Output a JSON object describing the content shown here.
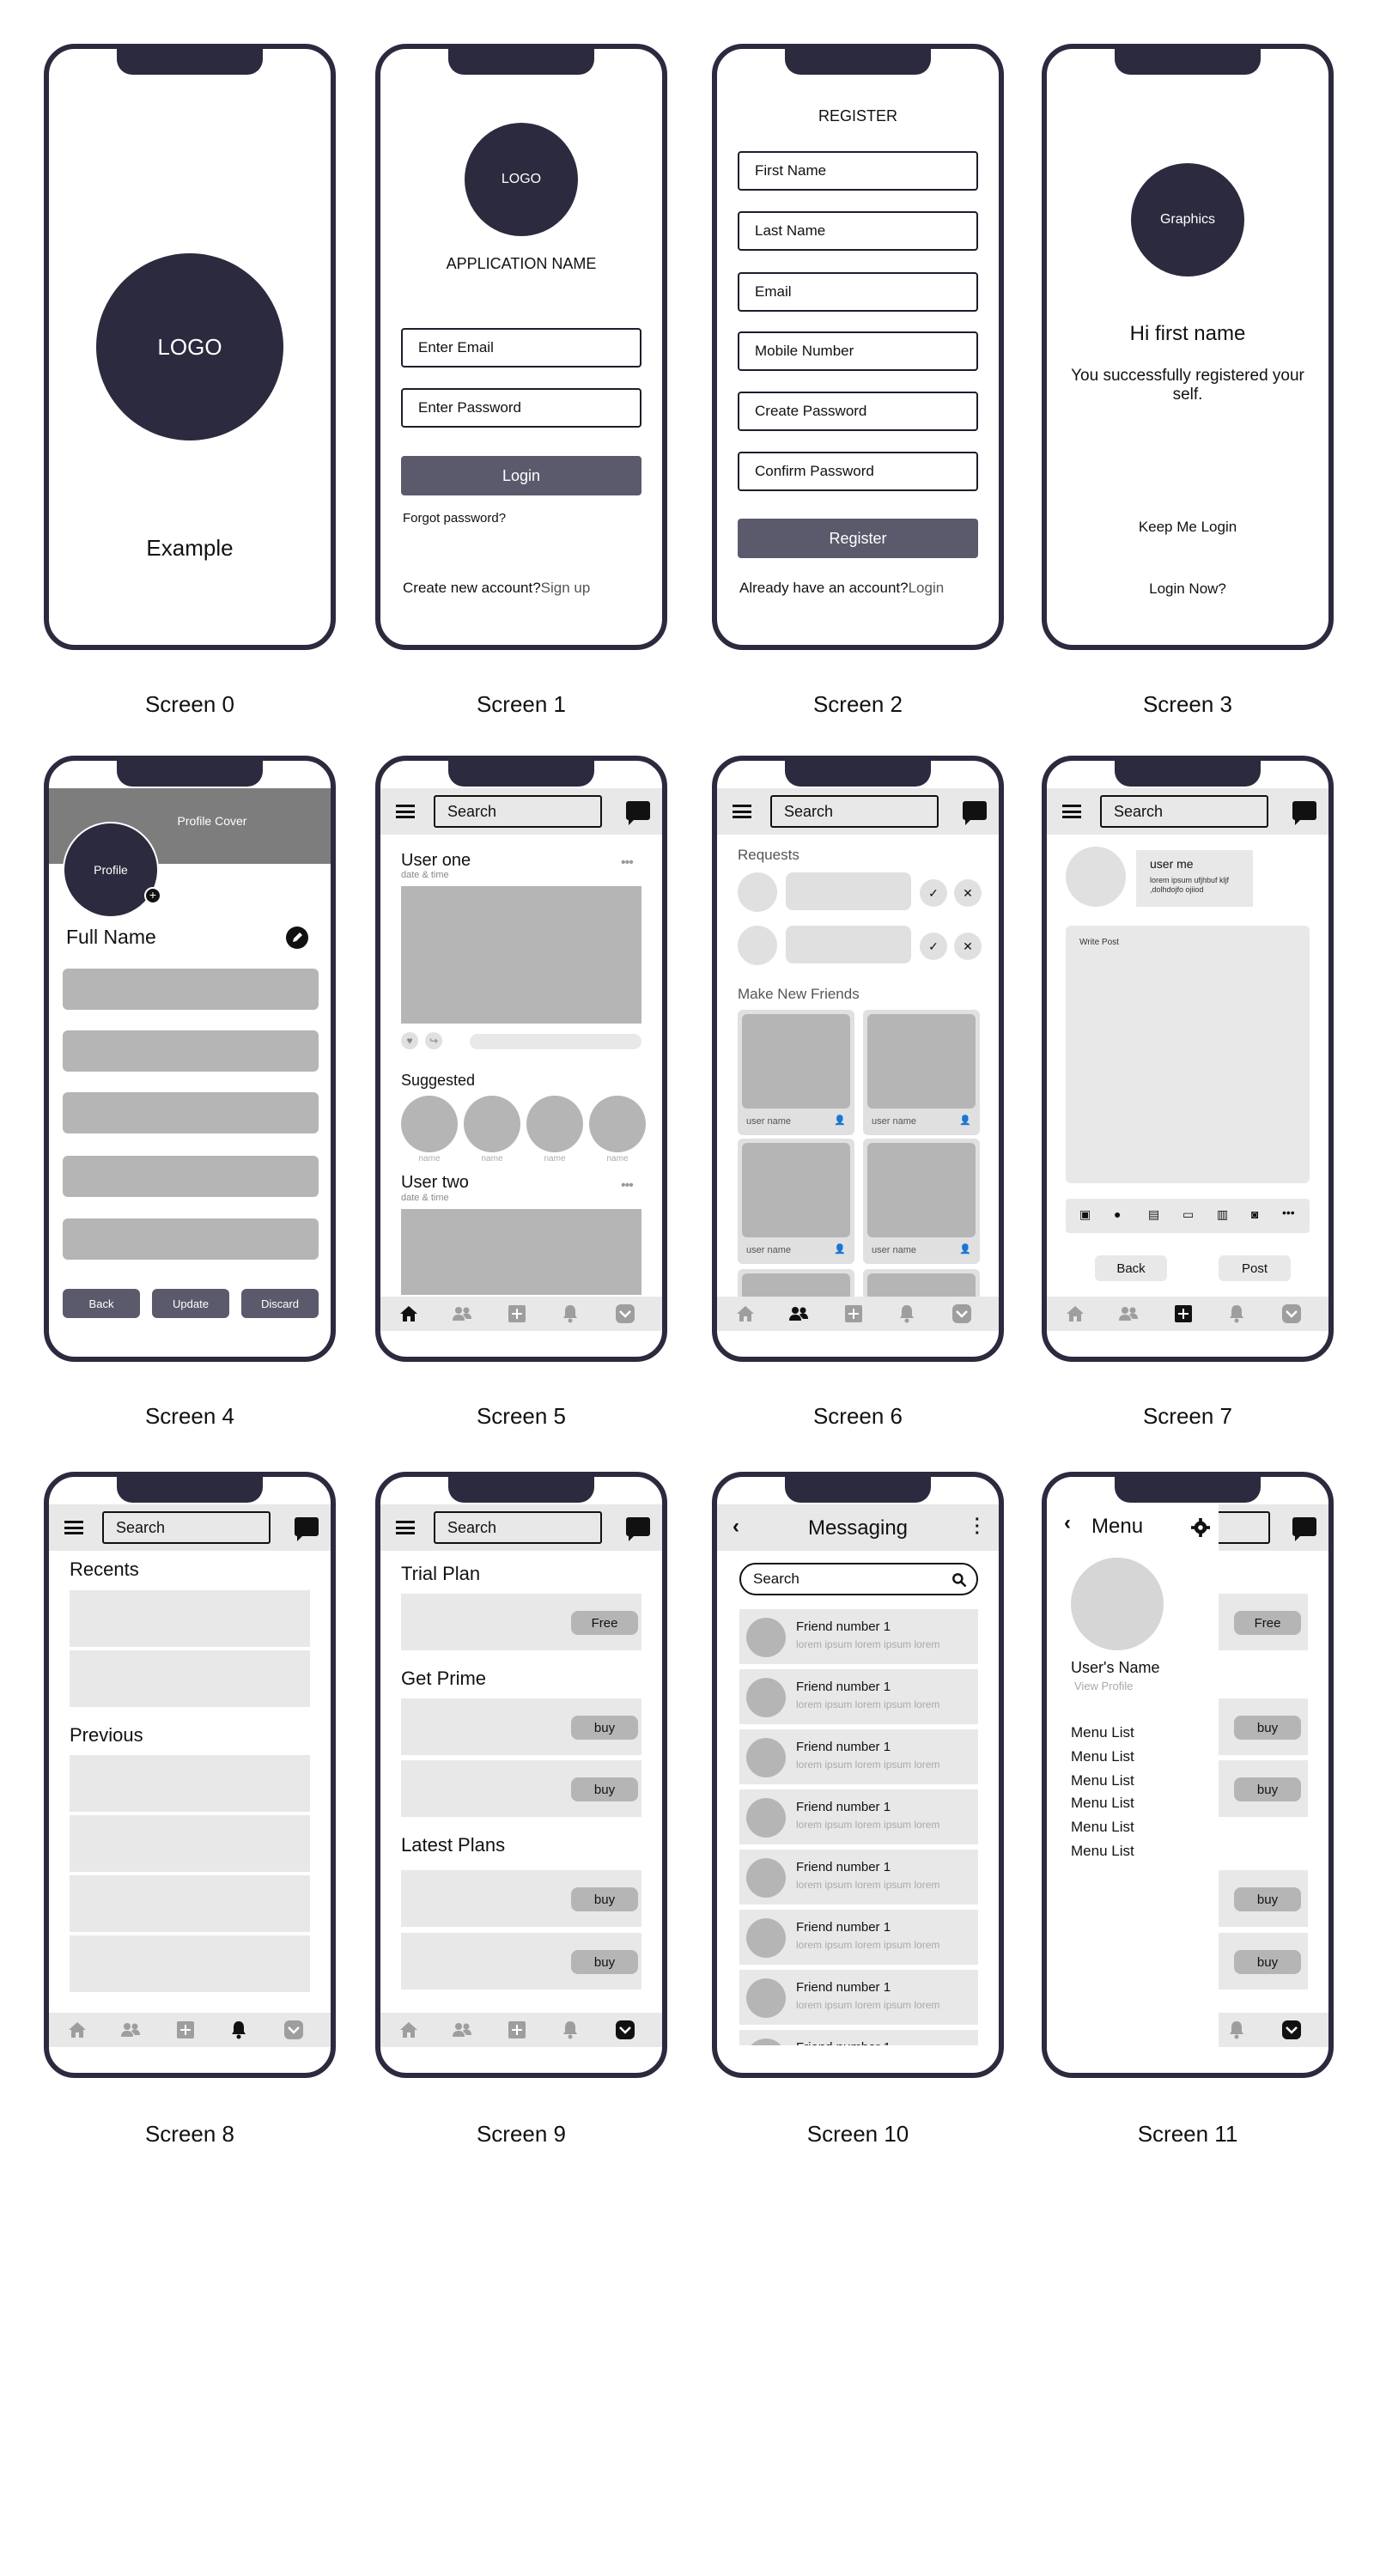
{
  "screens": {
    "s0": {
      "caption": "Screen 0",
      "logo": "LOGO",
      "title": "Example"
    },
    "s1": {
      "caption": "Screen 1",
      "logo": "LOGO",
      "app_name": "APPLICATION NAME",
      "email_placeholder": "Enter Email",
      "password_placeholder": "Enter Password",
      "login": "Login",
      "forgot": "Forgot password?",
      "create_text": "Create new account?",
      "signup": "Sign up"
    },
    "s2": {
      "caption": "Screen 2",
      "title": "REGISTER",
      "fields": [
        "First Name",
        "Last Name",
        "Email",
        "Mobile Number",
        "Create Password",
        "Confirm Password"
      ],
      "register": "Register",
      "have_account": "Already have an account?",
      "login": "Login"
    },
    "s3": {
      "caption": "Screen 3",
      "graphics": "Graphics",
      "greeting": "Hi first name",
      "message": "You successfully registered your self.",
      "keep": "Keep Me Login",
      "login_now": "Login Now?"
    },
    "s4": {
      "caption": "Screen 4",
      "cover": "Profile Cover",
      "profile": "Profile",
      "full_name": "Full Name",
      "back": "Back",
      "update": "Update",
      "discard": "Discard"
    },
    "s5": {
      "caption": "Screen 5",
      "search": "Search",
      "user1": "User one",
      "date": "date & time",
      "suggested": "Suggested",
      "name": "name",
      "user2": "User two"
    },
    "s6": {
      "caption": "Screen 6",
      "search": "Search",
      "requests": "Requests",
      "make_friends": "Make New Friends",
      "user_name": "user name"
    },
    "s7": {
      "caption": "Screen 7",
      "search": "Search",
      "user_me": "user me",
      "user_text": "lorem ipsum ufjhbuf kljf ,dolhdojfo ojiiod",
      "write_post": "Write Post",
      "back": "Back",
      "post": "Post"
    },
    "s8": {
      "caption": "Screen 8",
      "search": "Search",
      "recents": "Recents",
      "previous": "Previous"
    },
    "s9": {
      "caption": "Screen 9",
      "search": "Search",
      "trial": "Trial Plan",
      "free": "Free",
      "prime": "Get Prime",
      "buy": "buy",
      "latest": "Latest Plans"
    },
    "s10": {
      "caption": "Screen 10",
      "title": "Messaging",
      "search": "Search",
      "friend": "Friend number 1",
      "lorem": "lorem ipsum lorem ipsum lorem"
    },
    "s11": {
      "caption": "Screen 11",
      "menu": "Menu",
      "user_name": "User's Name",
      "view_profile": "View Profile",
      "menu_items": [
        "Menu List",
        "Menu List",
        "Menu List",
        "Menu List",
        "Menu List",
        "Menu List"
      ],
      "free": "Free",
      "buy": "buy"
    }
  },
  "colors": {
    "dark": "#2b2a3e",
    "button": "#5a5a6c",
    "grey": "#b5b5b5",
    "light": "#e8e8e8"
  }
}
